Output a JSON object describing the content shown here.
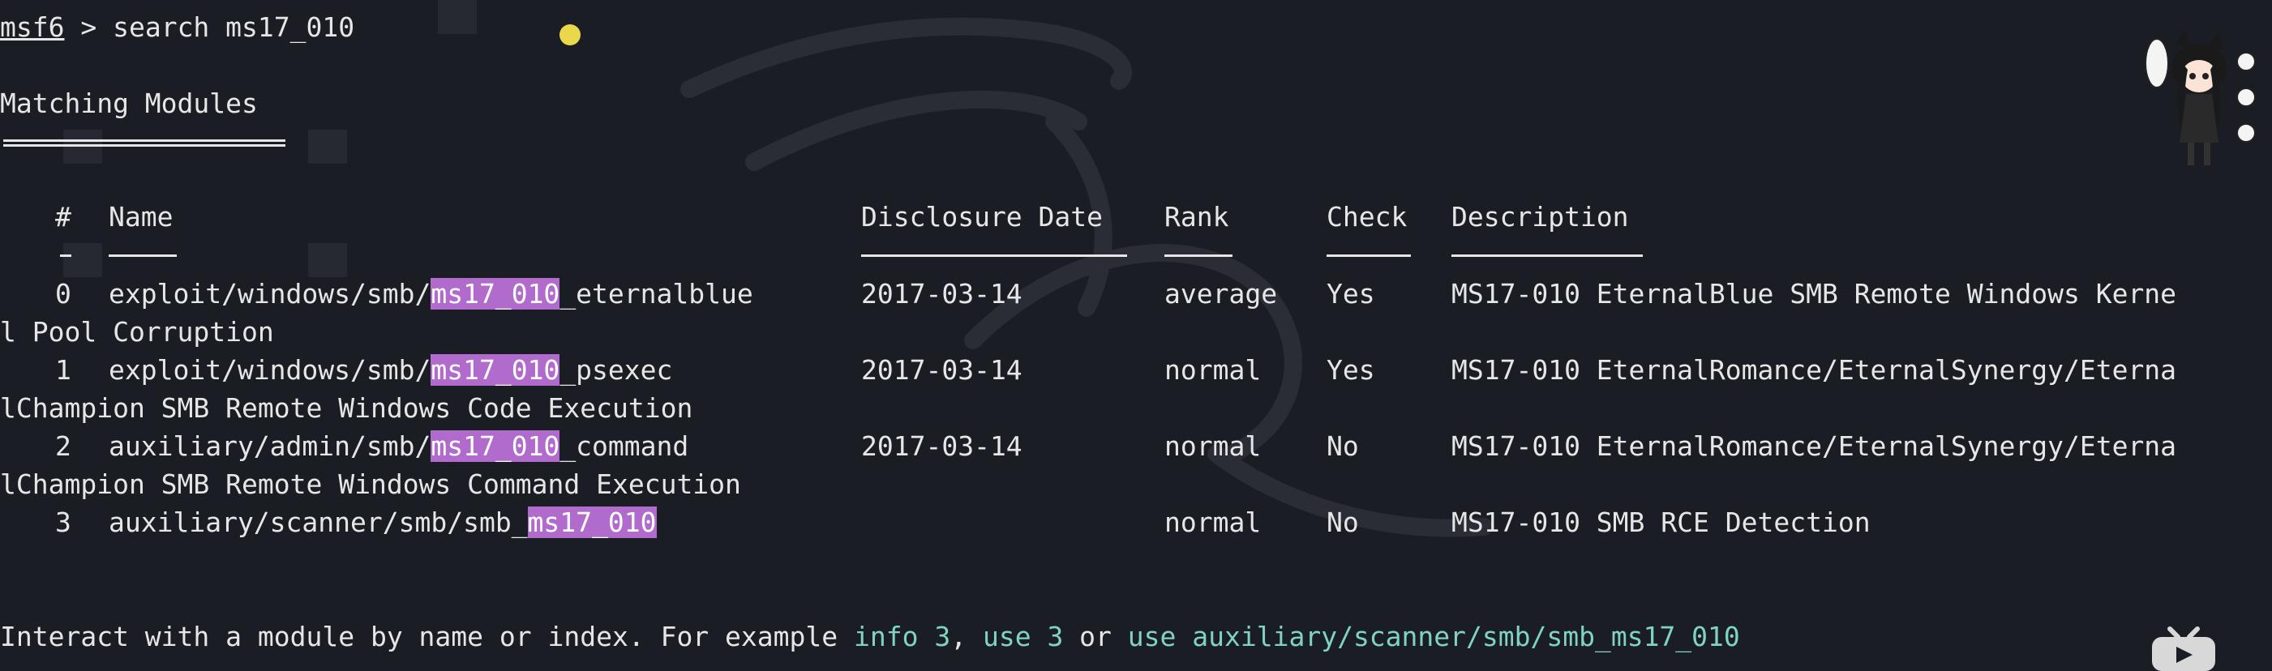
{
  "prompt": {
    "name": "msf6",
    "symbol": " > ",
    "command": "search ms17_010"
  },
  "section_title": "Matching Modules",
  "table": {
    "headers": {
      "index": "#",
      "name": "Name",
      "date": "Disclosure Date",
      "rank": "Rank",
      "check": "Check",
      "description": "Description"
    },
    "rows": [
      {
        "index": "0",
        "name_prefix": "exploit/windows/smb/",
        "name_match": "ms17_010",
        "name_suffix": "_eternalblue",
        "date": "2017-03-14",
        "rank": "average",
        "check": "Yes",
        "description": "MS17-010 EternalBlue SMB Remote Windows Kerne",
        "description_wrap": "l Pool Corruption"
      },
      {
        "index": "1",
        "name_prefix": "exploit/windows/smb/",
        "name_match": "ms17_010",
        "name_suffix": "_psexec",
        "date": "2017-03-14",
        "rank": "normal",
        "check": "Yes",
        "description": "MS17-010 EternalRomance/EternalSynergy/Eterna",
        "description_wrap": "lChampion SMB Remote Windows Code Execution"
      },
      {
        "index": "2",
        "name_prefix": "auxiliary/admin/smb/",
        "name_match": "ms17_010",
        "name_suffix": "_command",
        "date": "2017-03-14",
        "rank": "normal",
        "check": "No",
        "description": "MS17-010 EternalRomance/EternalSynergy/Eterna",
        "description_wrap": "lChampion SMB Remote Windows Command Execution"
      },
      {
        "index": "3",
        "name_prefix": "auxiliary/scanner/smb/smb_",
        "name_match": "ms17_010",
        "name_suffix": "",
        "date": "",
        "rank": "normal",
        "check": "No",
        "description": "MS17-010 SMB RCE Detection",
        "description_wrap": ""
      }
    ]
  },
  "footer": {
    "text_before": "Interact with a module by name or index. For example ",
    "example1": "info 3",
    "sep1": ", ",
    "example2": "use 3",
    "sep2": " or ",
    "example3": "use auxiliary/scanner/smb/smb_ms17_010"
  },
  "colors": {
    "background": "#1b1d24",
    "text": "#e6e6e6",
    "highlight": "#b16bcc",
    "link": "#7fd3c0"
  },
  "icons": {
    "cursor": "yellow-cursor-dot",
    "mascot": "anime-cat-girl-mascot",
    "overlay_logo": "bilibili-tv-icon"
  }
}
